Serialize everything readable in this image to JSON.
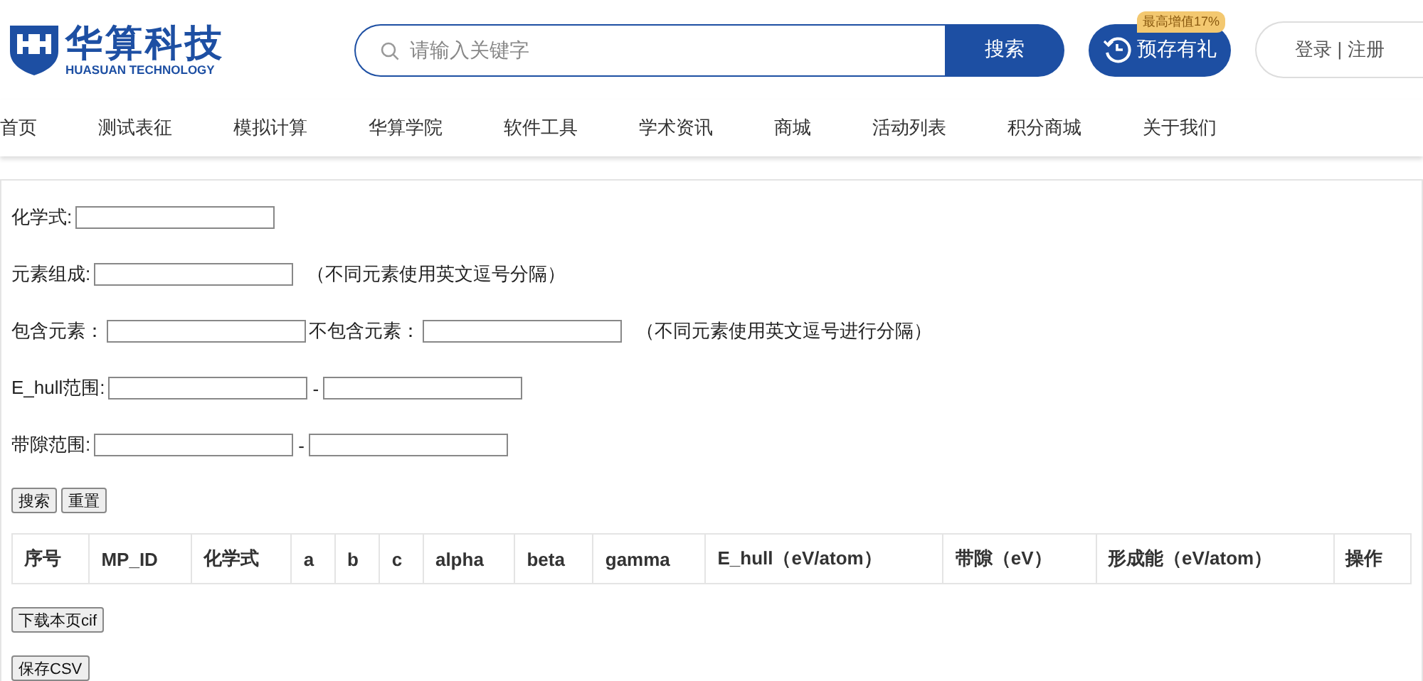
{
  "header": {
    "logo": {
      "name": "华算科技",
      "subtitle": "HUASUAN TECHNOLOGY"
    },
    "search": {
      "placeholder": "请输入关键字",
      "button": "搜索"
    },
    "promo": {
      "label": "预存有礼",
      "badge": "最高增值17%"
    },
    "login": "登录 | 注册"
  },
  "nav": [
    "首页",
    "测试表征",
    "模拟计算",
    "华算学院",
    "软件工具",
    "学术资讯",
    "商城",
    "活动列表",
    "积分商城",
    "关于我们"
  ],
  "form": {
    "rows": [
      [
        {
          "kind": "label",
          "text": "化学式:"
        },
        {
          "kind": "input"
        }
      ],
      [
        {
          "kind": "label",
          "text": "元素组成:"
        },
        {
          "kind": "input"
        },
        {
          "kind": "note",
          "text": "（不同元素使用英文逗号分隔）"
        }
      ],
      [
        {
          "kind": "label",
          "text": "包含元素："
        },
        {
          "kind": "input"
        },
        {
          "kind": "label",
          "text": "不包含元素："
        },
        {
          "kind": "input"
        },
        {
          "kind": "note",
          "text": "（不同元素使用英文逗号进行分隔）"
        }
      ],
      [
        {
          "kind": "label",
          "text": "E_hull范围:"
        },
        {
          "kind": "input"
        },
        {
          "kind": "sep",
          "text": "-"
        },
        {
          "kind": "input"
        }
      ],
      [
        {
          "kind": "label",
          "text": "带隙范围:"
        },
        {
          "kind": "input"
        },
        {
          "kind": "sep",
          "text": "-"
        },
        {
          "kind": "input"
        }
      ]
    ],
    "buttons": [
      "搜索",
      "重置"
    ]
  },
  "table": {
    "columns": [
      "序号",
      "MP_ID",
      "化学式",
      "a",
      "b",
      "c",
      "alpha",
      "beta",
      "gamma",
      "E_hull（eV/atom）",
      "带隙（eV）",
      "形成能（eV/atom）",
      "操作"
    ]
  },
  "actions": [
    "下载本页cif",
    "保存CSV"
  ]
}
